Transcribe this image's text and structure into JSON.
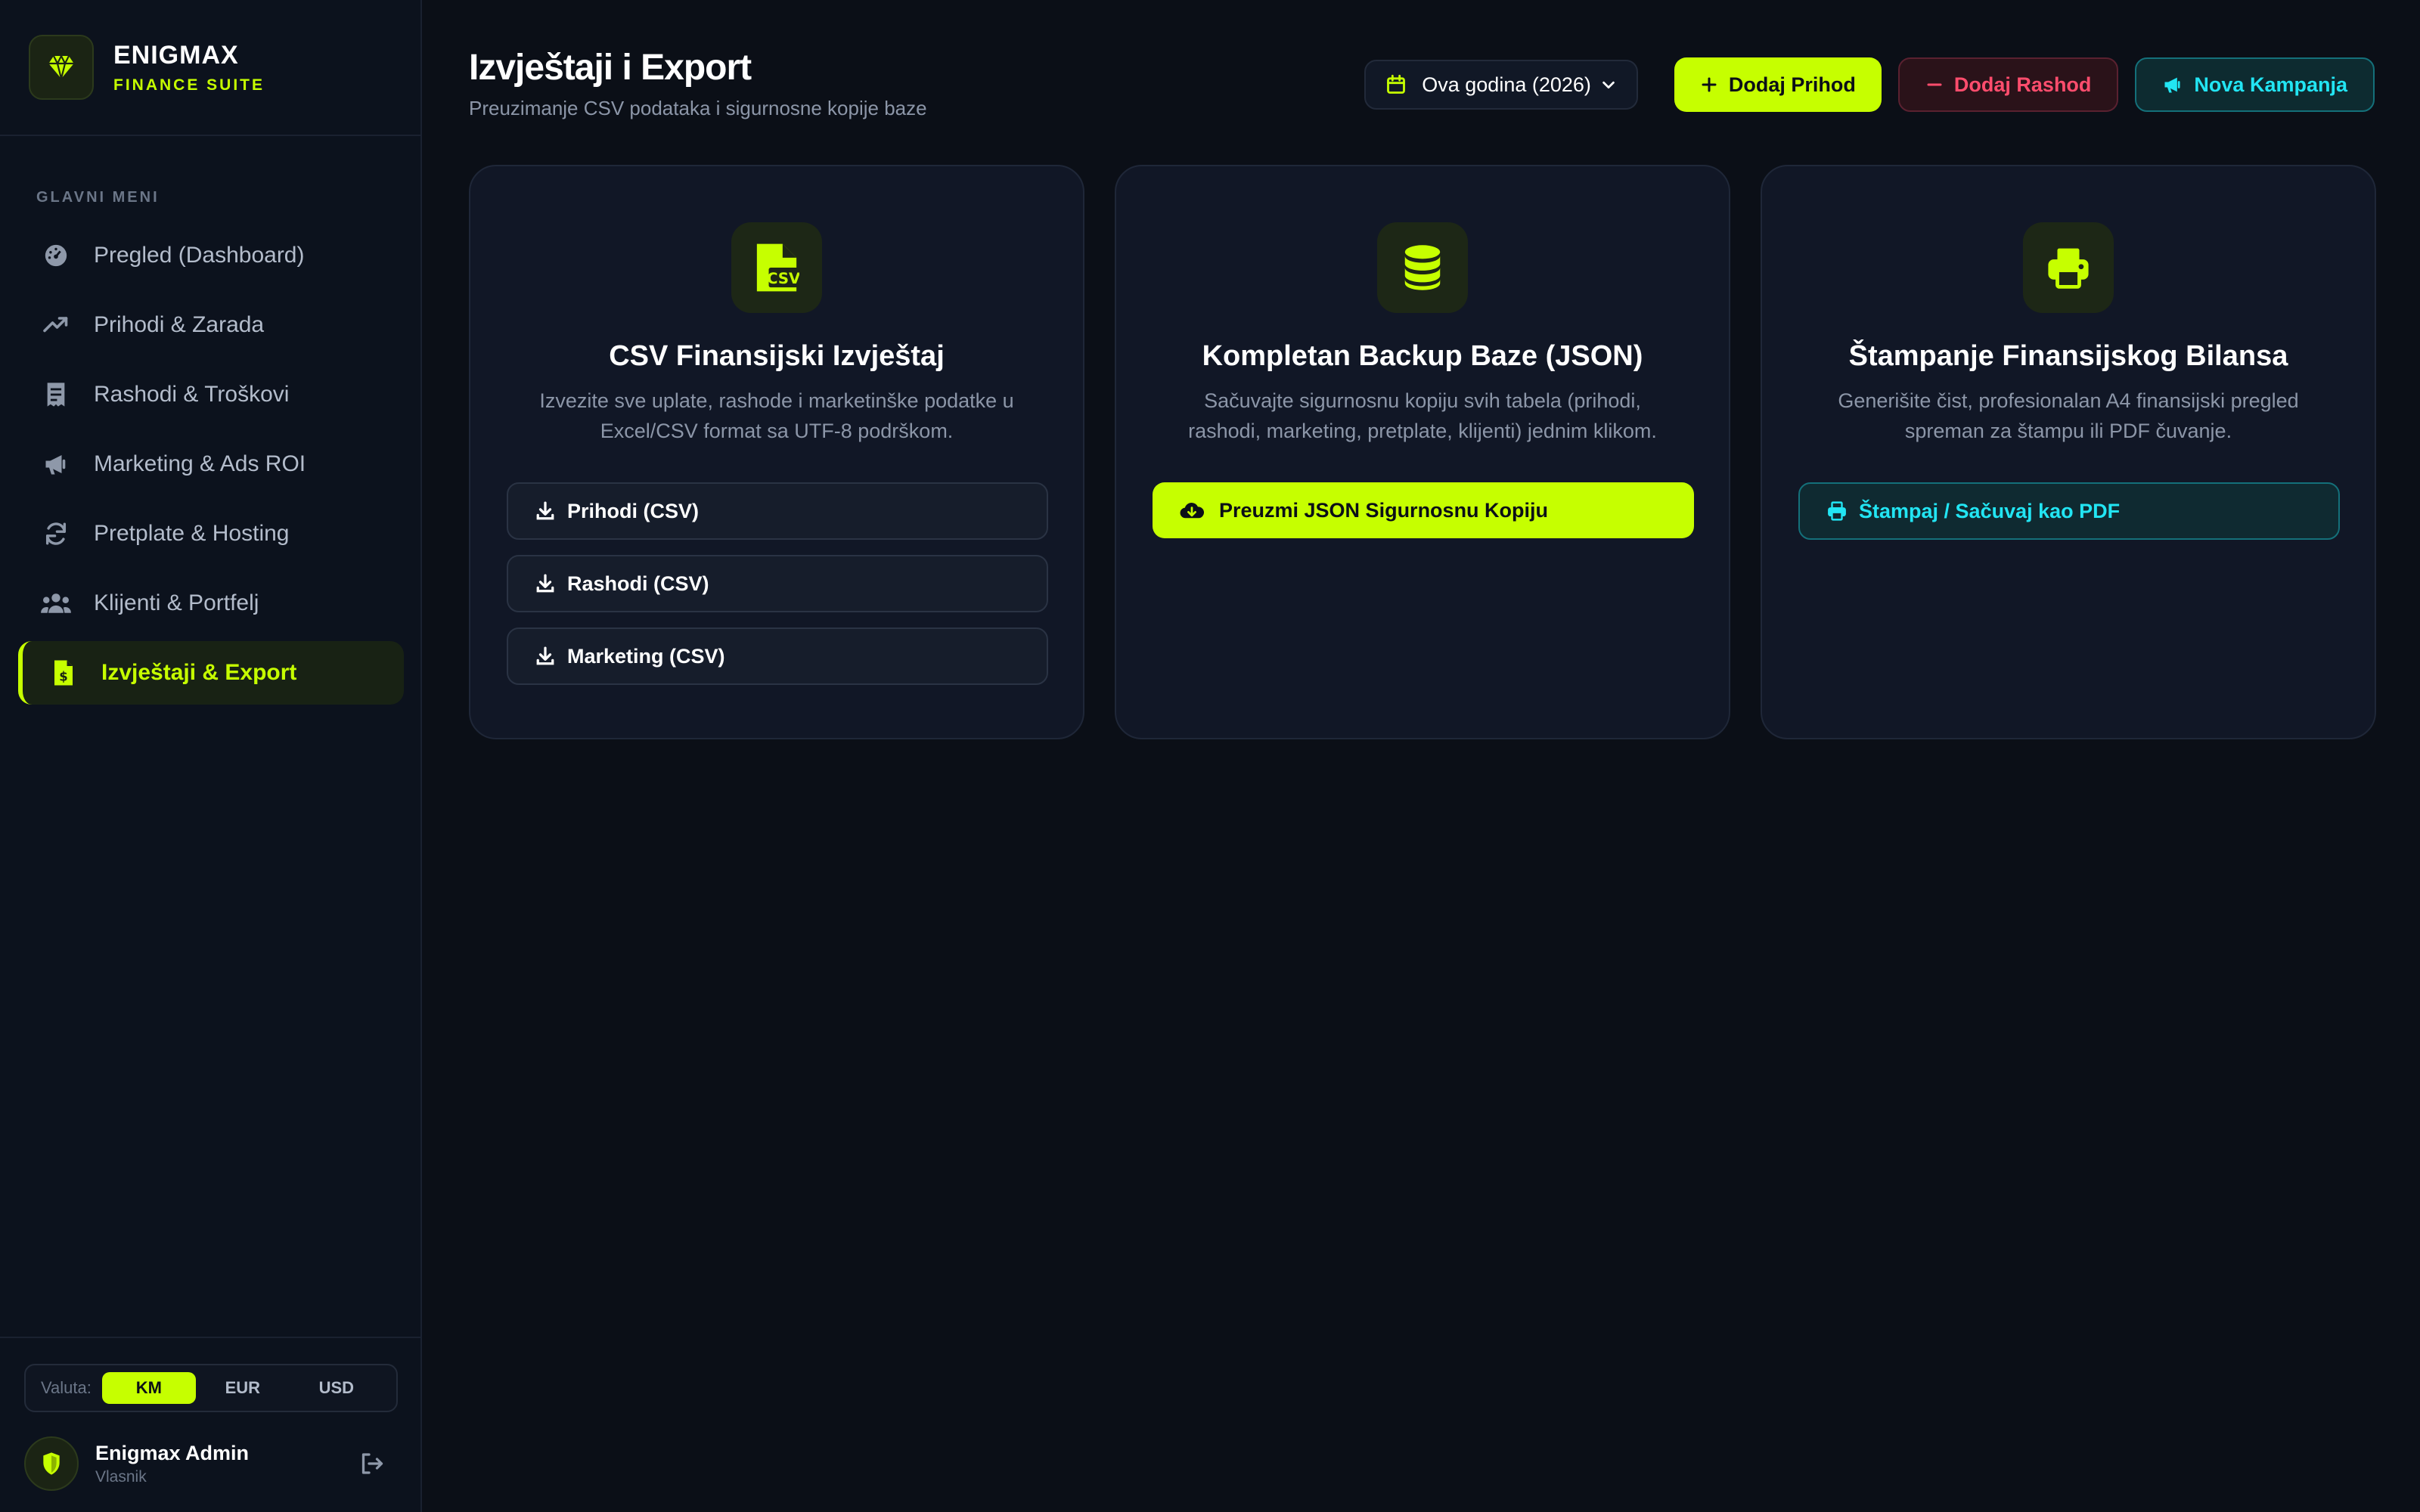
{
  "brand": {
    "name": "ENIGMAX",
    "subtitle": "FINANCE SUITE",
    "icon": "gem-icon"
  },
  "colors": {
    "accent": "#c6ff00",
    "danger": "#ff4d6d",
    "cyan": "#22e5f3",
    "background": "#0b0f17"
  },
  "sidebar": {
    "section_label": "GLAVNI MENI",
    "items": [
      {
        "label": "Pregled (Dashboard)",
        "icon": "gauge-icon",
        "active": false
      },
      {
        "label": "Prihodi & Zarada",
        "icon": "trend-up-icon",
        "active": false
      },
      {
        "label": "Rashodi & Troškovi",
        "icon": "receipt-icon",
        "active": false
      },
      {
        "label": "Marketing & Ads ROI",
        "icon": "megaphone-icon",
        "active": false
      },
      {
        "label": "Pretplate & Hosting",
        "icon": "refresh-icon",
        "active": false
      },
      {
        "label": "Klijenti & Portfelj",
        "icon": "users-icon",
        "active": false
      },
      {
        "label": "Izvještaji & Export",
        "icon": "invoice-icon",
        "active": true
      }
    ]
  },
  "currency": {
    "label": "Valuta:",
    "options": [
      "KM",
      "EUR",
      "USD"
    ],
    "selected": "KM"
  },
  "user": {
    "name": "Enigmax Admin",
    "role": "Vlasnik"
  },
  "header": {
    "title": "Izvještaji i Export",
    "subtitle": "Preuzimanje CSV podataka i sigurnosne kopije baze",
    "year_select": "Ova godina (2026)",
    "add_income": "Dodaj Prihod",
    "add_expense": "Dodaj Rashod",
    "new_campaign": "Nova Kampanja"
  },
  "cards": {
    "csv": {
      "title": "CSV Finansijski Izvještaj",
      "description": "Izvezite sve uplate, rashode i marketinške podatke u Excel/CSV format sa UTF-8 podrškom.",
      "buttons": [
        "Prihodi (CSV)",
        "Rashodi (CSV)",
        "Marketing (CSV)"
      ]
    },
    "backup": {
      "title": "Kompletan Backup Baze (JSON)",
      "description": "Sačuvajte sigurnosnu kopiju svih tabela (prihodi, rashodi, marketing, pretplate, klijenti) jednim klikom.",
      "button": "Preuzmi JSON Sigurnosnu Kopiju"
    },
    "print": {
      "title": "Štampanje Finansijskog Bilansa",
      "description": "Generišite čist, profesionalan A4 finansijski pregled spreman za štampu ili PDF čuvanje.",
      "button": "Štampaj / Sačuvaj kao PDF"
    }
  }
}
